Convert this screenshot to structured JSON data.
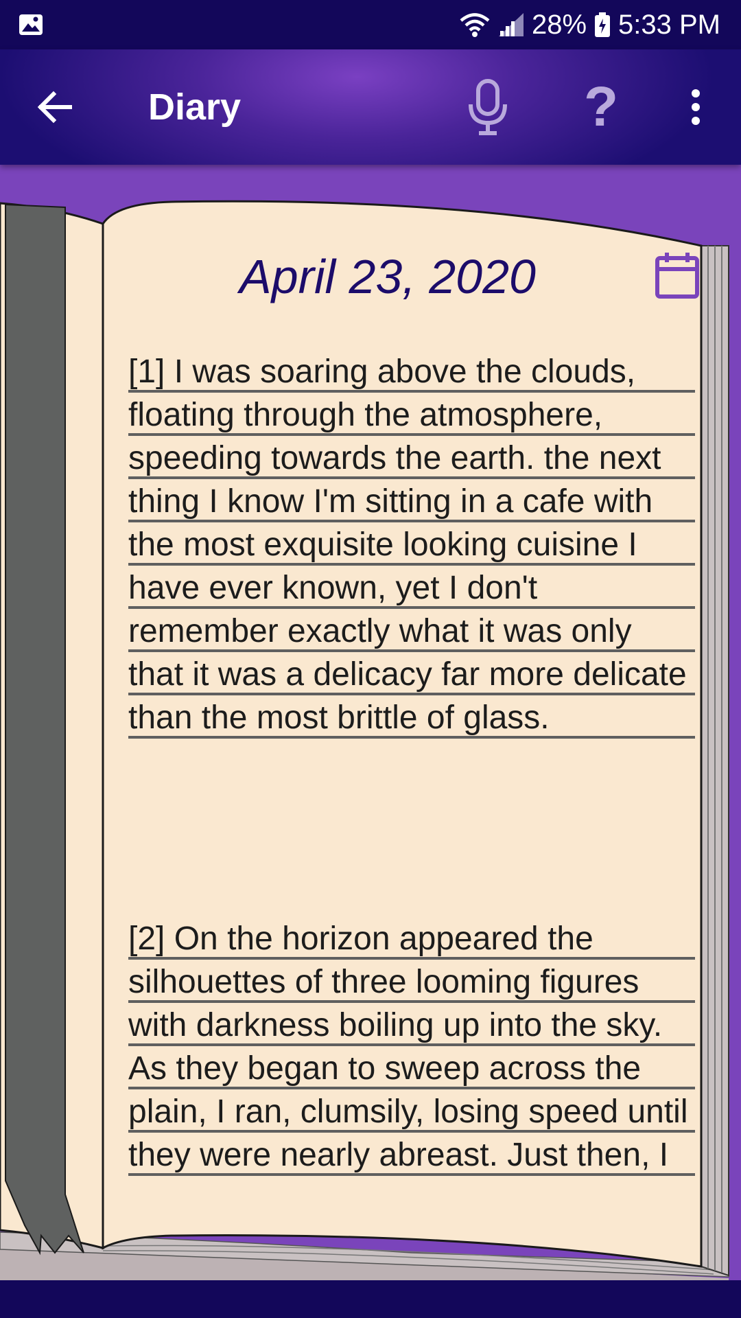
{
  "status_bar": {
    "battery": "28%",
    "time": "5:33 PM",
    "icons": [
      "image-icon",
      "wifi-icon",
      "signal-icon",
      "battery-icon"
    ]
  },
  "app_bar": {
    "title": "Diary",
    "help_label": "?",
    "icons": [
      "back-arrow-icon",
      "microphone-icon",
      "help-icon",
      "more-vert-icon"
    ]
  },
  "page": {
    "date": "April 23, 2020",
    "entries": [
      "[1] I was soaring above the clouds, floating through the atmosphere, speeding towards the earth. the next thing I know I'm sitting in a cafe with the most exquisite looking cuisine I have ever known, yet I don't remember exactly what it was only that it was a delicacy far more delicate than the most brittle of glass.",
      "[2] On the horizon appeared the silhouettes of three looming figures with darkness boiling up into the sky. As they began to sweep across the plain, I ran, clumsily, losing speed until they were nearly abreast. Just then, I"
    ]
  },
  "colors": {
    "status_bar": "#13075a",
    "app_bar": "#4a2499",
    "background": "#7a44bb",
    "page": "#fae8d0",
    "date_text": "#1c0c6a",
    "accent": "#7a44bb",
    "bookmark": "#5f6160"
  }
}
